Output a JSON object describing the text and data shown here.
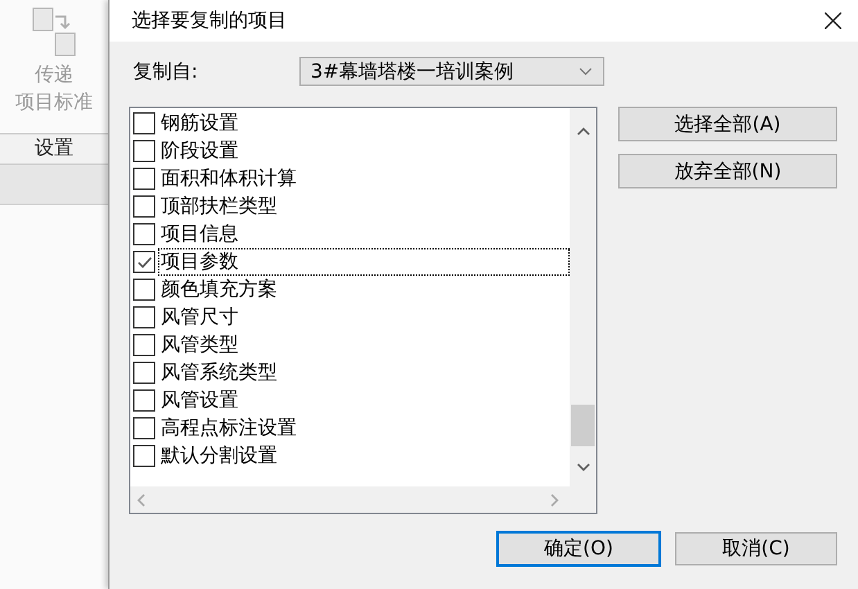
{
  "background_app": {
    "tool_label_lines": [
      "传递",
      "项目标准"
    ],
    "panel_tab": "设置"
  },
  "dialog": {
    "title": "选择要复制的项目",
    "copy_from": {
      "label": "复制自:",
      "value": "3#幕墙塔楼一培训案例"
    },
    "items": [
      {
        "label": "钢筋设置",
        "checked": false,
        "focused": false
      },
      {
        "label": "阶段设置",
        "checked": false,
        "focused": false
      },
      {
        "label": "面积和体积计算",
        "checked": false,
        "focused": false
      },
      {
        "label": "顶部扶栏类型",
        "checked": false,
        "focused": false
      },
      {
        "label": "项目信息",
        "checked": false,
        "focused": false
      },
      {
        "label": "项目参数",
        "checked": true,
        "focused": true
      },
      {
        "label": "颜色填充方案",
        "checked": false,
        "focused": false
      },
      {
        "label": "风管尺寸",
        "checked": false,
        "focused": false
      },
      {
        "label": "风管类型",
        "checked": false,
        "focused": false
      },
      {
        "label": "风管系统类型",
        "checked": false,
        "focused": false
      },
      {
        "label": "风管设置",
        "checked": false,
        "focused": false
      },
      {
        "label": "高程点标注设置",
        "checked": false,
        "focused": false
      },
      {
        "label": "默认分割设置",
        "checked": false,
        "focused": false
      }
    ],
    "side_buttons": [
      "选择全部(A)",
      "放弃全部(N)"
    ],
    "footer_buttons": [
      {
        "label": "确定(O)",
        "default": true
      },
      {
        "label": "取消(C)",
        "default": false
      }
    ]
  }
}
